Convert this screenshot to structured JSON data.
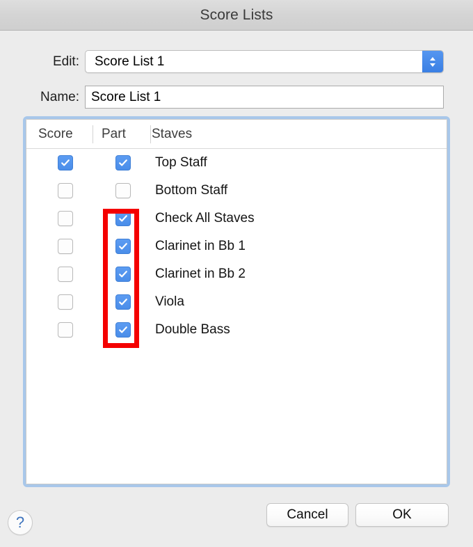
{
  "window": {
    "title": "Score Lists"
  },
  "form": {
    "edit_label": "Edit:",
    "edit_value": "Score List 1",
    "name_label": "Name:",
    "name_value": "Score List 1",
    "name_placeholder": "Score List 1"
  },
  "table": {
    "columns": [
      "Score",
      "Part",
      "Staves"
    ],
    "rows": [
      {
        "label": "Top Staff",
        "score": true,
        "part": true
      },
      {
        "label": "Bottom Staff",
        "score": false,
        "part": false
      },
      {
        "label": "Check All Staves",
        "score": false,
        "part": true
      },
      {
        "label": "Clarinet in Bb 1",
        "score": false,
        "part": true
      },
      {
        "label": "Clarinet in Bb 2",
        "score": false,
        "part": true
      },
      {
        "label": "Viola",
        "score": false,
        "part": true
      },
      {
        "label": "Double Bass",
        "score": false,
        "part": true
      }
    ]
  },
  "annotation": {
    "color": "#f40000",
    "target": "part-column-checkboxes",
    "rows_highlighted": [
      "Check All Staves",
      "Clarinet in Bb 1",
      "Clarinet in Bb 2",
      "Viola",
      "Double Bass"
    ]
  },
  "footer": {
    "help_label": "?",
    "cancel_label": "Cancel",
    "ok_label": "OK"
  },
  "colors": {
    "accent": "#4a8de9",
    "focus_ring": "#a8c7ea",
    "annotation": "#f40000",
    "window_background": "#ececec",
    "titlebar": "#d4d4d4",
    "help_glyph": "#3d73bd"
  }
}
